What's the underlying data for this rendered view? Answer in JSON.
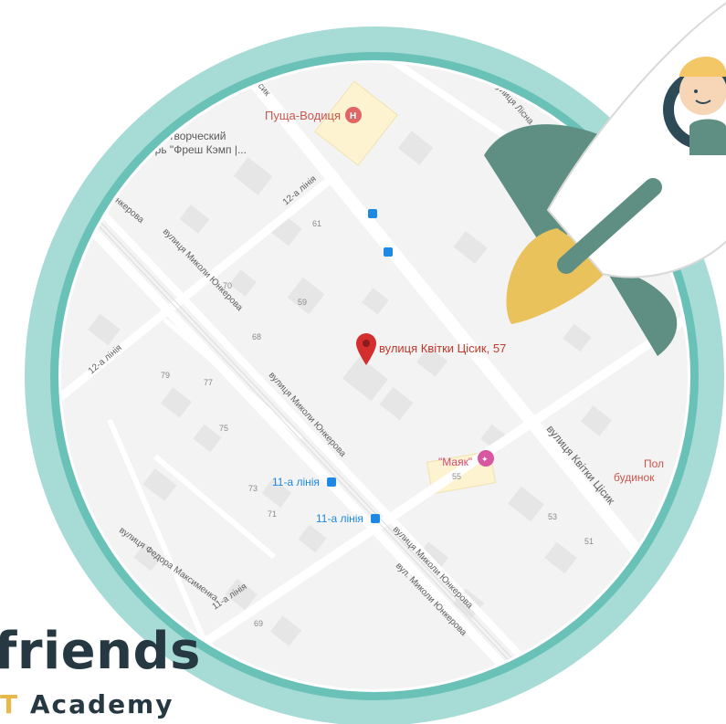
{
  "map": {
    "marker_label": "вулиця Квітки Цісик, 57",
    "pois": {
      "hospital": "Пуща-Водиця",
      "camp_line1": "кий творческий",
      "camp_line2": "ерь \"Фреш Кэмп |...",
      "mayak": "\"Маяк\"",
      "pol": "Пол",
      "budynok": "будинок"
    },
    "bus_stops": {
      "stop_a": "11-а лінія",
      "stop_b": "11-а лінія"
    },
    "streets": {
      "kvitky_main": "вулиця Квітки Цісик",
      "kvitky_top": "цісик",
      "lisna": "вулиця Лісна",
      "yunkerova_left": "Юнкерова",
      "yunkerova_1": "вулиця Миколи Юнкерова",
      "yunkerova_2": "вулиця Миколи Юнкерова",
      "yunkerova_3": "вулиця Миколи Юнкерова",
      "yunkerova_4": "вул. Миколи Юнкерова",
      "liniia_12_top": "12-а лінія",
      "liniia_12_left": "12-а лінія",
      "liniia_11": "11-а лінія",
      "maksymenka": "вулиця Федора Максименка"
    },
    "house_numbers": {
      "n61": "61",
      "n70": "70",
      "n59": "59",
      "n68": "68",
      "n79": "79",
      "n77": "77",
      "n75": "75",
      "n73": "73",
      "n71": "71",
      "n55": "55",
      "n53": "53",
      "n51": "51",
      "n69": "69"
    }
  },
  "logo": {
    "main": "friends",
    "sub_accent": "T",
    "sub_rest": " Academy"
  },
  "colors": {
    "ring_outer": "#a7dbd6",
    "ring_inner": "#69c1b8",
    "map_bg": "#f3f3f3",
    "road": "#ffffff",
    "marker": "#d32f2f",
    "poi_text": "#c9564d",
    "transit": "#1e88e5",
    "rocket_fin": "#5f8f82",
    "rocket_flame": "#e9c25c",
    "logo_dark": "#263842"
  }
}
